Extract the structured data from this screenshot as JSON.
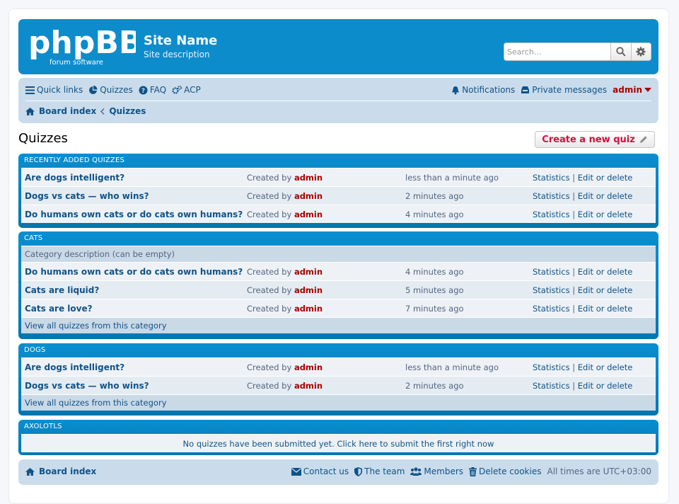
{
  "header": {
    "site_name": "Site Name",
    "site_desc": "Site description",
    "logo_main": "phpBB",
    "logo_sub": "forum software",
    "search_placeholder": "Search…"
  },
  "nav": {
    "quick_links": "Quick links",
    "quizzes": "Quizzes",
    "faq": "FAQ",
    "acp": "ACP",
    "notifications": "Notifications",
    "private_messages": "Private messages",
    "username": "admin"
  },
  "breadcrumb": {
    "home": "Board index",
    "current": "Quizzes"
  },
  "page": {
    "title": "Quizzes",
    "new_quiz": "Create a new quiz"
  },
  "labels": {
    "created_by": "Created by",
    "statistics": "Statistics",
    "sep": "|",
    "edit": "Edit or delete",
    "view_all": "View all quizzes from this category"
  },
  "sections": [
    {
      "title": "Recently added quizzes",
      "rows": [
        {
          "title": "Are dogs intelligent?",
          "author": "admin",
          "time": "less than a minute ago"
        },
        {
          "title": "Dogs vs cats — who wins?",
          "author": "admin",
          "time": "2 minutes ago"
        },
        {
          "title": "Do humans own cats or do cats own humans?",
          "author": "admin",
          "time": "4 minutes ago"
        }
      ]
    },
    {
      "title": "Cats",
      "description": "Category description (can be empty)",
      "rows": [
        {
          "title": "Do humans own cats or do cats own humans?",
          "author": "admin",
          "time": "4 minutes ago"
        },
        {
          "title": "Cats are liquid?",
          "author": "admin",
          "time": "5 minutes ago"
        },
        {
          "title": "Cats are love?",
          "author": "admin",
          "time": "7 minutes ago"
        }
      ]
    },
    {
      "title": "Dogs",
      "rows": [
        {
          "title": "Are dogs intelligent?",
          "author": "admin",
          "time": "less than a minute ago"
        },
        {
          "title": "Dogs vs cats — who wins?",
          "author": "admin",
          "time": "2 minutes ago"
        }
      ]
    },
    {
      "title": "Axolotls",
      "empty": "No quizzes have been submitted yet. Click here to submit the first right now"
    }
  ],
  "footer": {
    "home": "Board index",
    "contact": "Contact us",
    "team": "The team",
    "members": "Members",
    "delete_cookies": "Delete cookies",
    "timezone": "All times are UTC+03:00"
  },
  "colors": {
    "accent": "#0076b1",
    "link": "#105289",
    "admin": "#aa0000",
    "button_text": "#d31141"
  }
}
